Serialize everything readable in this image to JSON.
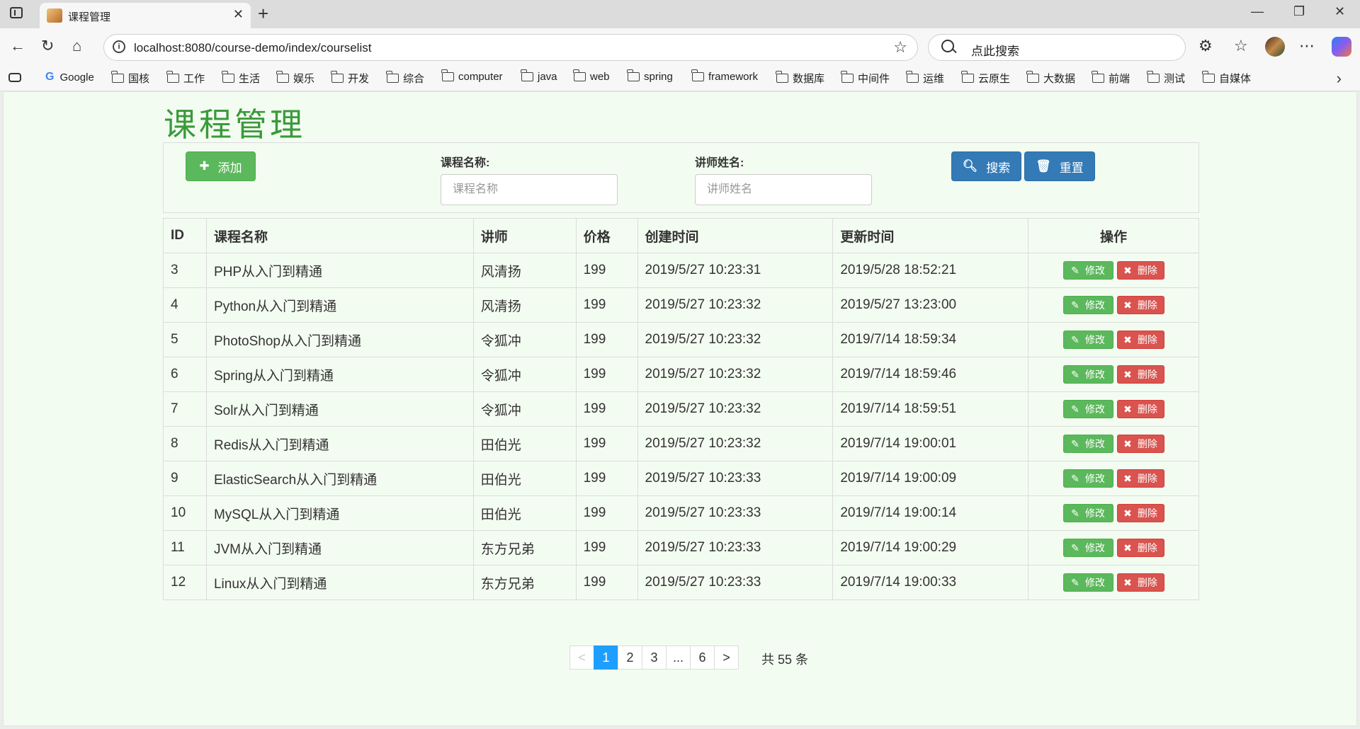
{
  "browser": {
    "tab_title": "课程管理",
    "tab_close": "✕",
    "new_tab": "+",
    "url": "localhost:8080/course-demo/index/courselist",
    "search_placeholder": "点此搜索",
    "win_minimize": "—",
    "win_restore": "❐",
    "win_close": "✕",
    "bookmarks": [
      "Google",
      "国核",
      "工作",
      "生活",
      "娱乐",
      "开发",
      "综合",
      "computer",
      "java",
      "web",
      "spring",
      "framework",
      "数据库",
      "中间件",
      "运维",
      "云原生",
      "大数据",
      "前端",
      "测试",
      "自媒体"
    ]
  },
  "page": {
    "title": "课程管理",
    "add_label": "添加",
    "course_name_label": "课程名称:",
    "course_name_placeholder": "课程名称",
    "teacher_label": "讲师姓名:",
    "teacher_placeholder": "讲师姓名",
    "search_label": "搜索",
    "reset_label": "重置"
  },
  "table": {
    "headers": [
      "ID",
      "课程名称",
      "讲师",
      "价格",
      "创建时间",
      "更新时间",
      "操作"
    ],
    "edit_label": "修改",
    "delete_label": "删除",
    "rows": [
      {
        "id": "3",
        "name": "PHP从入门到精通",
        "teacher": "风清扬",
        "price": "199",
        "created": "2019/5/27 10:23:31",
        "updated": "2019/5/28 18:52:21"
      },
      {
        "id": "4",
        "name": "Python从入门到精通",
        "teacher": "风清扬",
        "price": "199",
        "created": "2019/5/27 10:23:32",
        "updated": "2019/5/27 13:23:00"
      },
      {
        "id": "5",
        "name": "PhotoShop从入门到精通",
        "teacher": "令狐冲",
        "price": "199",
        "created": "2019/5/27 10:23:32",
        "updated": "2019/7/14 18:59:34"
      },
      {
        "id": "6",
        "name": "Spring从入门到精通",
        "teacher": "令狐冲",
        "price": "199",
        "created": "2019/5/27 10:23:32",
        "updated": "2019/7/14 18:59:46"
      },
      {
        "id": "7",
        "name": "Solr从入门到精通",
        "teacher": "令狐冲",
        "price": "199",
        "created": "2019/5/27 10:23:32",
        "updated": "2019/7/14 18:59:51"
      },
      {
        "id": "8",
        "name": "Redis从入门到精通",
        "teacher": "田伯光",
        "price": "199",
        "created": "2019/5/27 10:23:32",
        "updated": "2019/7/14 19:00:01"
      },
      {
        "id": "9",
        "name": "ElasticSearch从入门到精通",
        "teacher": "田伯光",
        "price": "199",
        "created": "2019/5/27 10:23:33",
        "updated": "2019/7/14 19:00:09"
      },
      {
        "id": "10",
        "name": "MySQL从入门到精通",
        "teacher": "田伯光",
        "price": "199",
        "created": "2019/5/27 10:23:33",
        "updated": "2019/7/14 19:00:14"
      },
      {
        "id": "11",
        "name": "JVM从入门到精通",
        "teacher": "东方兄弟",
        "price": "199",
        "created": "2019/5/27 10:23:33",
        "updated": "2019/7/14 19:00:29"
      },
      {
        "id": "12",
        "name": "Linux从入门到精通",
        "teacher": "东方兄弟",
        "price": "199",
        "created": "2019/5/27 10:23:33",
        "updated": "2019/7/14 19:00:33"
      }
    ]
  },
  "pagination": {
    "prev": "<",
    "pages": [
      "1",
      "2",
      "3",
      "...",
      "6"
    ],
    "next": ">",
    "current": "1",
    "total_text": "共 55 条"
  },
  "colors": {
    "page_bg": "#f3fcf1",
    "title": "#3a9a3a",
    "success": "#5cb85c",
    "primary": "#337ab7",
    "danger": "#d9534f",
    "pager_active": "#1e9fff"
  },
  "icons": {
    "add": "plus-icon",
    "search": "search-icon",
    "reset": "trash-icon",
    "edit": "pencil-icon",
    "delete": "x-icon"
  }
}
